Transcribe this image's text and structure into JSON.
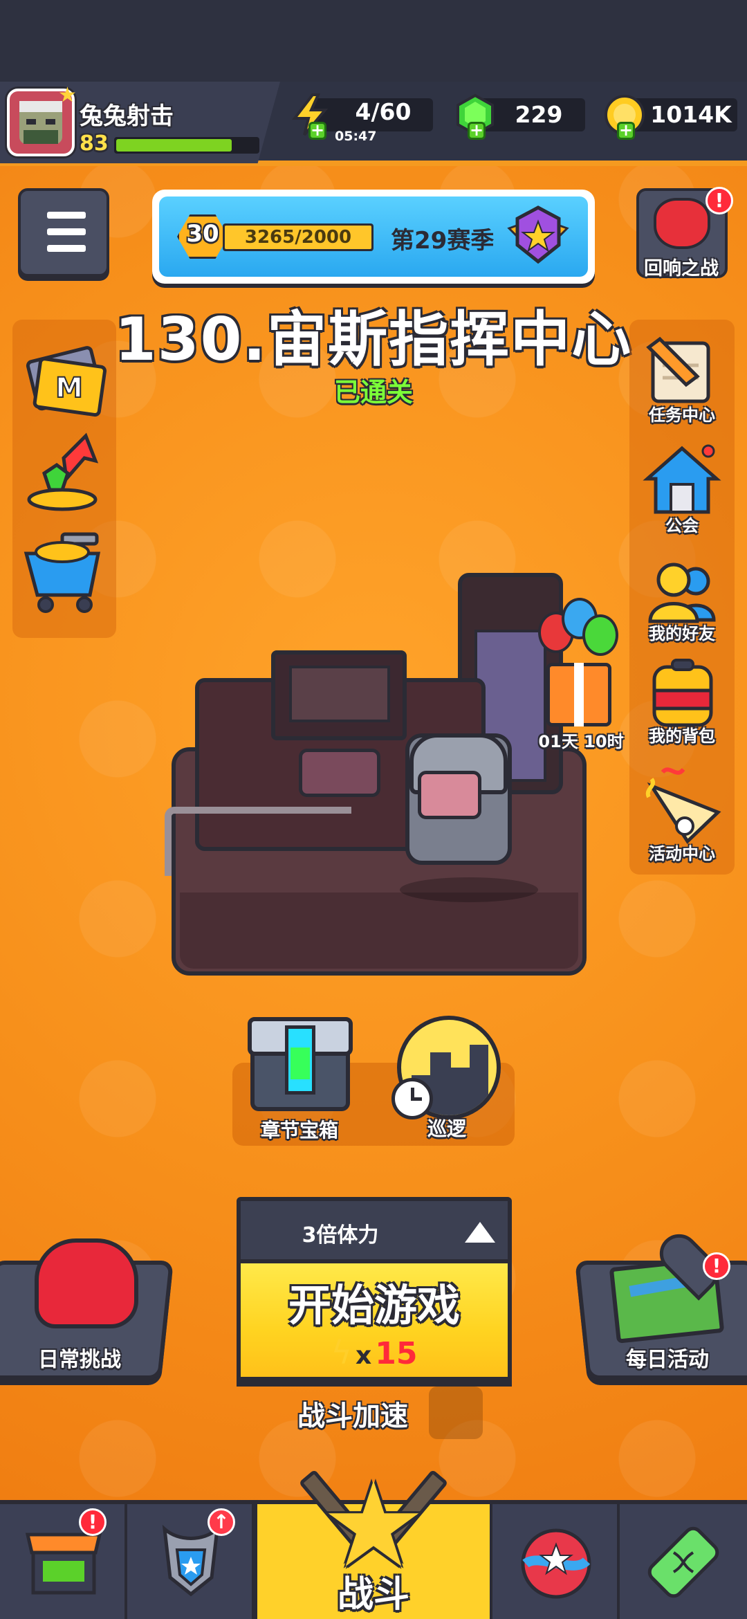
{
  "player": {
    "name": "兔兔射击",
    "level": "83",
    "xp_fraction": 0.82
  },
  "resources": {
    "energy": {
      "value": "4/60",
      "timer": "05:47",
      "icon": "lightning-icon"
    },
    "gems": {
      "value": "229",
      "icon": "green-gem-icon"
    },
    "coins": {
      "value": "1014K",
      "icon": "gold-coin-icon"
    }
  },
  "season": {
    "level": "30",
    "progress": "3265/2000",
    "progress_fraction": 1.0,
    "label": "第29赛季",
    "icon": "purple-star-badge-icon"
  },
  "echo_battle": {
    "label": "回响之战",
    "badge": "!"
  },
  "stage": {
    "title": "130.宙斯指挥中心",
    "status": "已通关"
  },
  "left_menu": [
    {
      "name": "m-card-icon"
    },
    {
      "name": "growth-fund-icon"
    },
    {
      "name": "shop-cart-icon"
    }
  ],
  "right_menu": [
    {
      "label": "任务中心",
      "icon": "scroll-pencil-icon"
    },
    {
      "label": "公会",
      "icon": "guild-house-icon"
    },
    {
      "label": "我的好友",
      "icon": "friends-icon"
    },
    {
      "label": "我的背包",
      "icon": "backpack-icon"
    },
    {
      "label": "活动中心",
      "icon": "party-horn-icon"
    }
  ],
  "gift": {
    "timer": "01天 10时"
  },
  "chapter_chest": {
    "label": "章节宝箱"
  },
  "patrol": {
    "label": "巡逻"
  },
  "start": {
    "multiplier_label": "3倍体力",
    "button_label": "开始游戏",
    "cost_x": "x",
    "cost_value": "15"
  },
  "battle_speed": {
    "label": "战斗加速"
  },
  "daily_challenge": {
    "label": "日常挑战"
  },
  "daily_event": {
    "label": "每日活动",
    "badge": "!"
  },
  "nav": {
    "battle_label": "战斗",
    "shop_badge": "!",
    "badge_icon": "!"
  },
  "colors": {
    "bg": "#f58a1a",
    "accent": "#ffd12a",
    "dark": "#2f3344",
    "alert": "#ff2a3a",
    "cleared": "#7cff38"
  }
}
